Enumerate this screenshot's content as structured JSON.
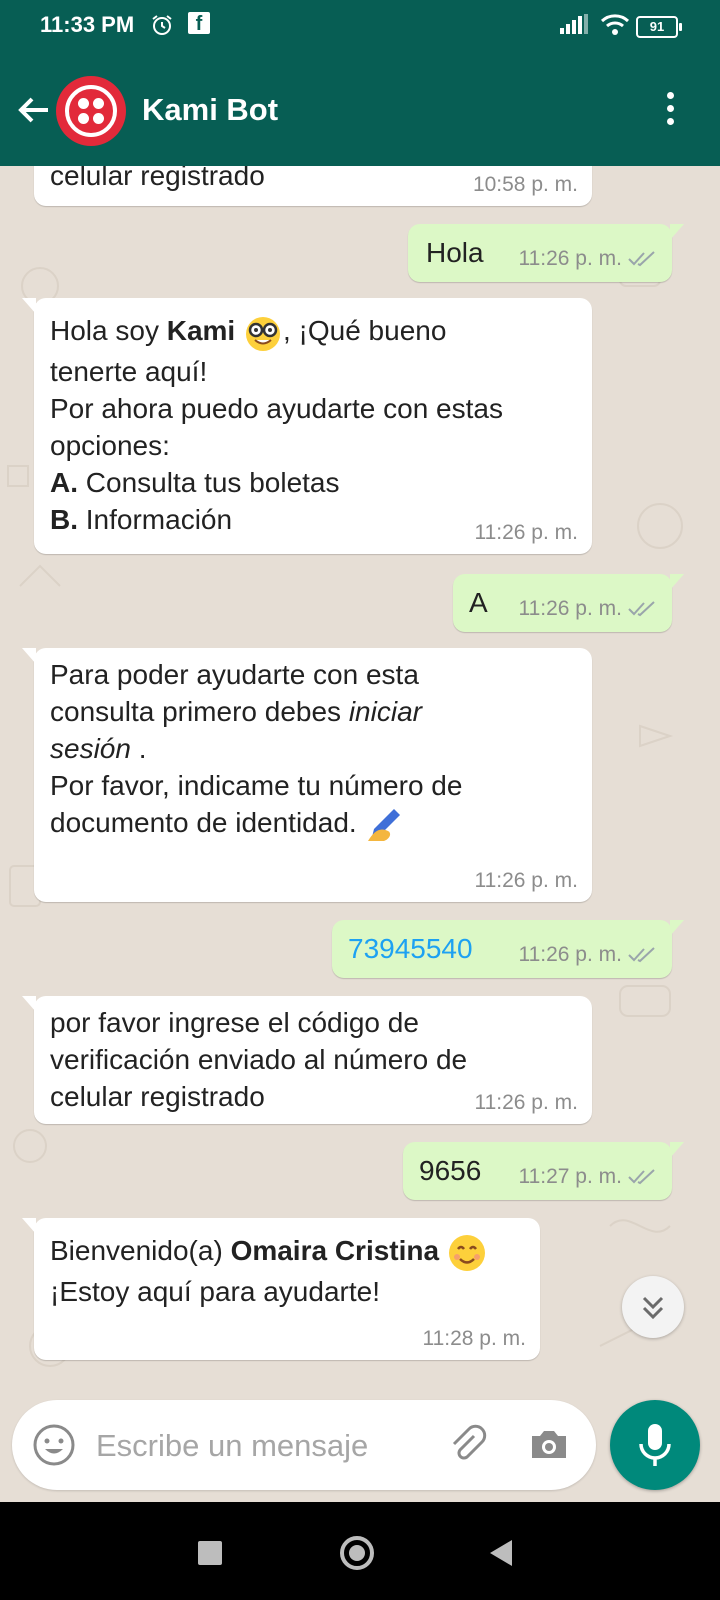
{
  "status_bar": {
    "time": "11:33 PM",
    "battery": "91"
  },
  "header": {
    "title": "Kami Bot"
  },
  "messages": [
    {
      "dir": "in",
      "text": "celular registrado",
      "time": "10:58 p. m."
    },
    {
      "dir": "out",
      "text": "Hola",
      "time": "11:26 p. m."
    },
    {
      "dir": "in",
      "p1": "Hola soy ",
      "p1_bold": "Kami",
      "p1_after": ",  ¡Qué bueno",
      "p2": "tenerte aquí!",
      "p3": "Por ahora puedo ayudarte con estas",
      "p4": "opciones:",
      "opt_a_key": "A.",
      "opt_a_text": " Consulta tus boletas",
      "opt_b_key": "B.",
      "opt_b_text": " Información",
      "time": "11:26 p. m."
    },
    {
      "dir": "out",
      "text": "A",
      "time": "11:26 p. m."
    },
    {
      "dir": "in",
      "p1": "Para poder ayudarte con esta",
      "p2": "consulta primero debes ",
      "p2_italic": "iniciar",
      "p3_italic": "sesión",
      "p3_after": " .",
      "p4": "Por favor, indicame tu número de",
      "p5": "documento de identidad. ",
      "time": "11:26 p. m."
    },
    {
      "dir": "out",
      "text": "73945540",
      "time": "11:26 p. m."
    },
    {
      "dir": "in",
      "p1": "por favor ingrese el código de",
      "p2": "verificación enviado al número de",
      "p3": "celular registrado",
      "time": "11:26 p. m."
    },
    {
      "dir": "out",
      "text": "9656",
      "time": "11:27 p. m."
    },
    {
      "dir": "in",
      "p1": "Bienvenido(a) ",
      "p1_bold": "Omaira Cristina",
      "p2": "¡Estoy aquí para ayudarte!",
      "time": "11:28 p. m."
    }
  ],
  "composer": {
    "placeholder": "Escribe un mensaje"
  },
  "colors": {
    "header": "#075e54",
    "outgoing": "#dcf8c6",
    "incoming": "#ffffff",
    "mic": "#00897b",
    "link": "#1da1f2"
  },
  "icons": [
    "back-arrow-icon",
    "more-vert-icon",
    "alarm-icon",
    "facebook-icon",
    "signal-icon",
    "wifi-icon",
    "battery-icon",
    "double-check-icon",
    "nerd-face-icon",
    "writing-hand-icon",
    "smiling-face-icon",
    "chevron-double-down-icon",
    "emoji-icon",
    "attach-icon",
    "camera-icon",
    "mic-icon",
    "nav-recent-icon",
    "nav-home-icon",
    "nav-back-icon"
  ]
}
